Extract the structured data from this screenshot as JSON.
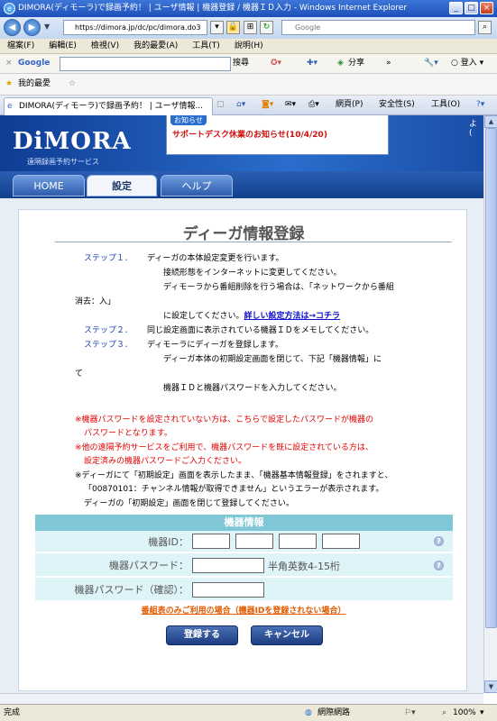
{
  "window": {
    "title": "DIMORA(ディモーラ)で録画予約！ | ユーザ情報 | 機器登録 / 機器ＩＤ入力 - Windows Internet Explorer",
    "url": "https://dimora.jp/dc/pc/dimora.do3",
    "search_placeholder": "Google"
  },
  "menu": [
    "檔案(F)",
    "編輯(E)",
    "檢視(V)",
    "我的最愛(A)",
    "工具(T)",
    "說明(H)"
  ],
  "google_toolbar": {
    "logo": "Google",
    "search_label": "搜尋",
    "share_label": "分享",
    "login_label": "登入"
  },
  "favorites": {
    "label": "我的最愛"
  },
  "tab": {
    "title": "DIMORA(ディモーラ)で録画予約！ | ユーザ情報...",
    "page_label": "網頁(P)",
    "safety_label": "安全性(S)",
    "tools_label": "工具(O)"
  },
  "site": {
    "logo": "DiMORA",
    "logo_sub": "遠隔録画予約サービス",
    "news_label": "お知らせ",
    "news_text": "サポートデスク休業のお知らせ(10/4/20)",
    "tabs": [
      "HOME",
      "設定",
      "ヘルプ"
    ]
  },
  "form": {
    "heading": "ディーガ情報登録",
    "step1_label": "ステップ１．",
    "step1_lines": [
      "ディーガの本体設定変更を行います。",
      "接続形態をインターネットに変更してください。",
      "ディモーラから番組削除を行う場合は、「ネットワークから番組",
      "消去：入」",
      "に設定してください。"
    ],
    "step1_link": "詳しい設定方法は→コチラ",
    "step2_label": "ステップ２．",
    "step2_text": "同じ設定画面に表示されている機器ＩＤをメモしてください。",
    "step3_label": "ステップ３．",
    "step3_lines": [
      "ディモーラにディーガを登録します。",
      "ディーガ本体の初期設定画面を閉じて、下記「機器情報」に",
      "て",
      "機器ＩＤと機器パスワードを入力してください。"
    ],
    "notes": [
      "※機器パスワードを設定されていない方は、こちらで設定したパスワードが機器の",
      "パスワードとなります。",
      "※他の遠隔予約サービスをご利用で、機器パスワードを既に設定されている方は、",
      "設定済みの機器パスワードご入力ください。",
      "※ディーガにて「初期設定」画面を表示したまま、「機器基本情報登録」をされますと、",
      "「00870101：チャンネル情報が取得できません」というエラーが表示されます。",
      "ディーガの「初期設定」画面を閉じて登録してください。"
    ],
    "table_title": "機器情報",
    "device_id_label": "機器ID：",
    "password_label": "機器パスワード：",
    "password_hint": "半角英数4-15桁",
    "password_confirm_label": "機器パスワード（確認）：",
    "notice_link": "番組表のみご利用の場合（機器IDを登録されない場合）",
    "submit_label": "登録する",
    "cancel_label": "キャンセル"
  },
  "status": {
    "left": "完成",
    "zone": "網際網路",
    "zoom": "100%"
  }
}
